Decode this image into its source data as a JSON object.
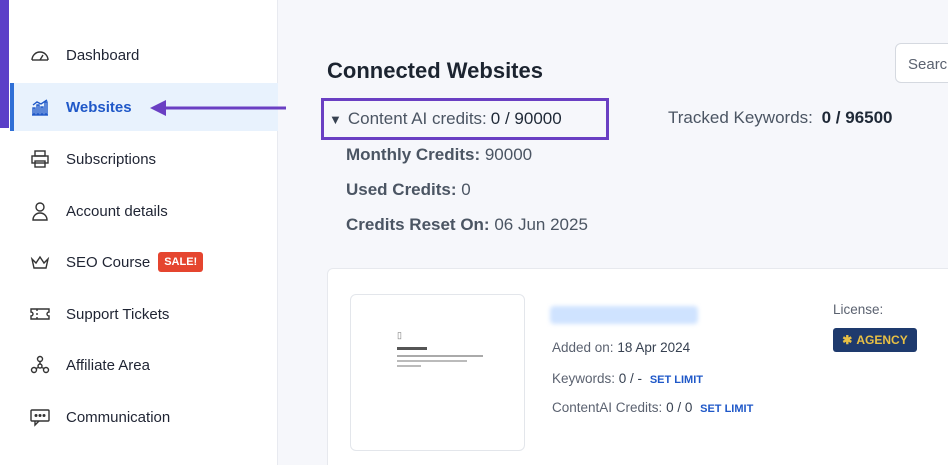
{
  "sidebar": {
    "items": [
      {
        "label": "Dashboard",
        "icon": "speedometer-icon"
      },
      {
        "label": "Websites",
        "icon": "bar-chart-icon",
        "active": true
      },
      {
        "label": "Subscriptions",
        "icon": "printer-icon"
      },
      {
        "label": "Account details",
        "icon": "user-icon"
      },
      {
        "label": "SEO Course",
        "icon": "crown-icon",
        "badge": "SALE!"
      },
      {
        "label": "Support Tickets",
        "icon": "ticket-icon"
      },
      {
        "label": "Affiliate Area",
        "icon": "network-icon"
      },
      {
        "label": "Communication",
        "icon": "chat-icon"
      }
    ]
  },
  "main": {
    "title": "Connected Websites",
    "search": {
      "placeholder": "Search"
    },
    "credits": {
      "content_ai_label": "Content AI credits:",
      "content_ai_value": "0 / 90000",
      "tracked_label": "Tracked Keywords:",
      "tracked_value": "0 / 96500",
      "monthly_label": "Monthly Credits:",
      "monthly_value": "90000",
      "used_label": "Used Credits:",
      "used_value": "0",
      "reset_label": "Credits Reset On:",
      "reset_value": "06 Jun 2025"
    },
    "site_card": {
      "added_label": "Added on:",
      "added_value": "18 Apr 2024",
      "keywords_label": "Keywords:",
      "keywords_value": "0 / -",
      "contentai_label": "ContentAI Credits:",
      "contentai_value": "0 / 0",
      "set_limit": "SET LIMIT",
      "license_label": "License:",
      "license_value": "AGENCY"
    }
  },
  "colors": {
    "accent_purple": "#6a3fc3",
    "active_blue": "#1f58c8",
    "sale_red": "#e5452f",
    "agency_navy": "#1e3a6d"
  }
}
